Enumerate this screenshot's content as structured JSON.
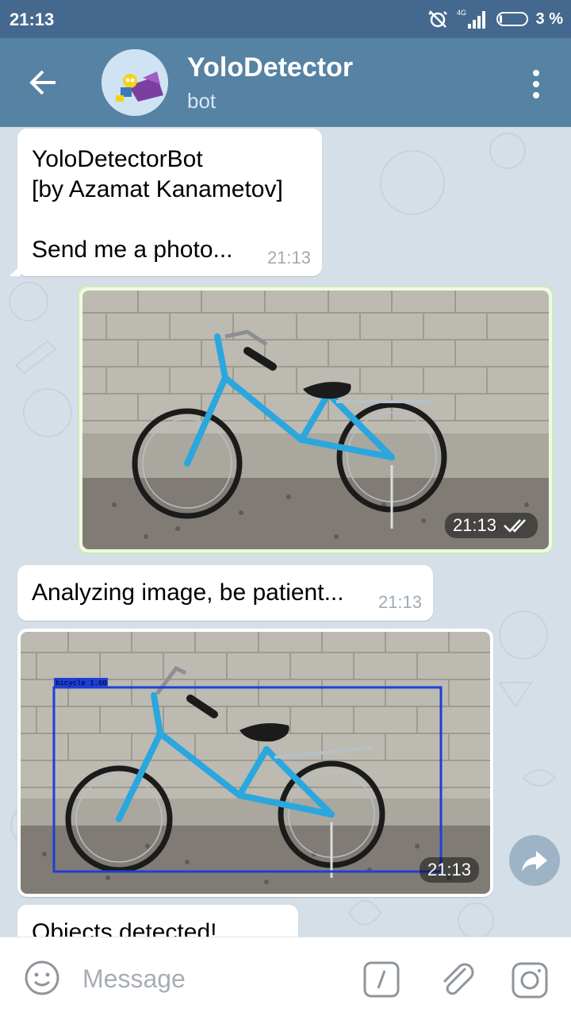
{
  "status_bar": {
    "time": "21:13",
    "network": "4G",
    "battery": "3 %"
  },
  "header": {
    "title": "YoloDetector",
    "subtitle": "bot"
  },
  "messages": [
    {
      "text": "YoloDetectorBot\n[by Azamat Kanametov]\n\nSend me a photo...",
      "time": "21:13"
    },
    {
      "type": "photo",
      "direction": "outgoing",
      "time": "21:13",
      "status": "read"
    },
    {
      "text": "Analyzing image, be patient...",
      "time": "21:13"
    },
    {
      "type": "photo",
      "direction": "incoming",
      "time": "21:13",
      "detection_label": "bicycle 1.00"
    },
    {
      "text": "Objects detected!"
    }
  ],
  "input": {
    "placeholder": "Message"
  },
  "colors": {
    "status_bar": "#45688e",
    "header": "#5682a3",
    "chat_bg": "#d5dfe8",
    "outgoing_bubble": "#eefbe2",
    "box": "#1d3fd8"
  },
  "icons": [
    "back-arrow-icon",
    "more-vert-icon",
    "double-check-icon",
    "forward-icon",
    "emoji-icon",
    "slash-command-icon",
    "attach-icon",
    "camera-icon"
  ]
}
